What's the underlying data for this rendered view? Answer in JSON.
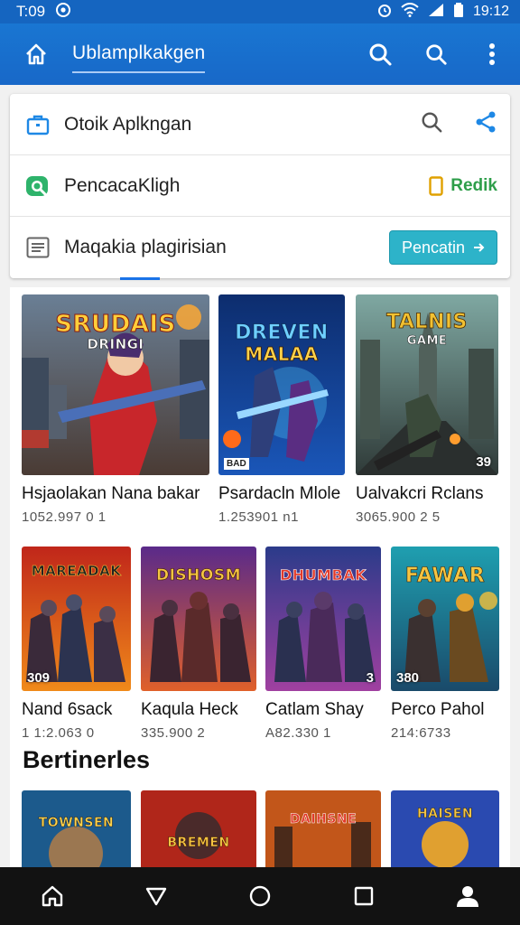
{
  "status_bar": {
    "time_left": "T:09",
    "time_right": "19:12"
  },
  "app_bar": {
    "title": "Ublamplkakgen"
  },
  "menu": {
    "row1": {
      "label": "Otoik Aplkngan"
    },
    "row2": {
      "label": "PencacaKligh",
      "right_label": "Redik"
    },
    "row3": {
      "label": "Maqakia  plagirisian",
      "button_label": "Pencatin"
    }
  },
  "games_row1": [
    {
      "logo": "SRUDAIS",
      "logo2": "DRINGI",
      "name": "Hsjaolakan Nana bakar",
      "meta": "1052.997 0 1",
      "badge": ""
    },
    {
      "logo": "DREVEN",
      "logo2": "MALAA",
      "name": "Psardacln Mlole",
      "meta": "1.253901 n1",
      "badge": "BAD"
    },
    {
      "logo": "TALNIS",
      "logo2": "GAME",
      "name": "Ualvakcri Rclans",
      "meta": "3065.900 2 5",
      "badge": "39"
    }
  ],
  "games_row2": [
    {
      "logo": "MAREADAK",
      "name": "Nand 6sack",
      "meta": "1 1:2.063 0",
      "badge": "309"
    },
    {
      "logo": "DISHOSM",
      "name": "Kaqula Heck",
      "meta": "335.900 2",
      "badge": ""
    },
    {
      "logo": "DHUMBAK",
      "name": "Catlam Shay",
      "meta": "A82.330 1",
      "badge": "3"
    },
    {
      "logo": "FAWAR",
      "name": "Perco Pahol",
      "meta": "214:6733",
      "badge": "380"
    }
  ],
  "section": {
    "title": "Bertinerles"
  },
  "games_row3": [
    {
      "logo": "TOWNSEN"
    },
    {
      "logo": "BREMEN"
    },
    {
      "logo": "DAIHSNE"
    },
    {
      "logo": "HAISEN"
    }
  ],
  "colors": {
    "primary": "#1a73e8",
    "accent_teal": "#2db3c9",
    "green": "#2e9e4a"
  }
}
